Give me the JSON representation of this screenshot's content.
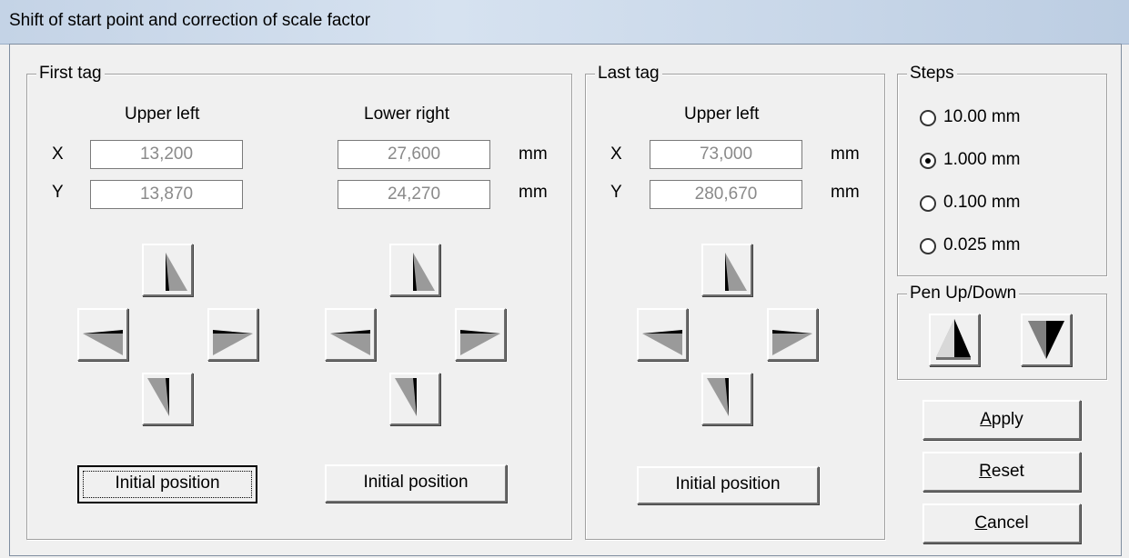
{
  "window": {
    "title": "Shift of start point and correction of scale factor"
  },
  "first_tag": {
    "legend": "First tag",
    "upper_left": {
      "heading": "Upper left",
      "x": "13,200",
      "y": "13,870"
    },
    "lower_right": {
      "heading": "Lower right",
      "x": "27,600",
      "y": "24,270"
    },
    "x_label": "X",
    "y_label": "Y",
    "unit": "mm",
    "initial_position_label": "Initial position"
  },
  "last_tag": {
    "legend": "Last tag",
    "upper_left": {
      "heading": "Upper left",
      "x": "73,000",
      "y": "280,670"
    },
    "x_label": "X",
    "y_label": "Y",
    "unit": "mm",
    "initial_position_label": "Initial position"
  },
  "steps": {
    "legend": "Steps",
    "options": [
      "10.00 mm",
      "1.000 mm",
      "0.100 mm",
      "0.025 mm"
    ],
    "selected": "1.000 mm"
  },
  "pen": {
    "legend": "Pen Up/Down",
    "up_icon": "pen-up-icon",
    "down_icon": "pen-down-icon"
  },
  "buttons": {
    "apply": {
      "prefix": "",
      "accel": "A",
      "rest": "pply"
    },
    "reset": {
      "prefix": "",
      "accel": "R",
      "rest": "eset"
    },
    "cancel": {
      "prefix": "",
      "accel": "C",
      "rest": "ancel"
    }
  },
  "icons": [
    "arrow-up-icon",
    "arrow-left-icon",
    "arrow-right-icon",
    "arrow-down-icon"
  ]
}
